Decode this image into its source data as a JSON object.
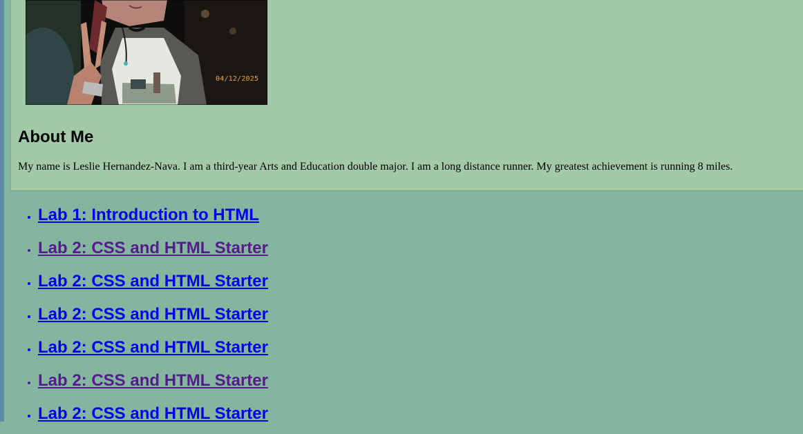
{
  "photo": {
    "date_stamp": "04/12/2025"
  },
  "about": {
    "heading": "About Me",
    "text": "My name is Leslie Hernandez-Nava. I am a third-year Arts and Education double major. I am a long distance runner. My greatest achievement is running 8 miles."
  },
  "labs": [
    {
      "label": "Lab 1: Introduction to HTML",
      "visited": false
    },
    {
      "label": "Lab 2: CSS and HTML Starter",
      "visited": true
    },
    {
      "label": "Lab 2: CSS and HTML Starter",
      "visited": false
    },
    {
      "label": "Lab 2: CSS and HTML Starter",
      "visited": false
    },
    {
      "label": "Lab 2: CSS and HTML Starter",
      "visited": false
    },
    {
      "label": "Lab 2: CSS and HTML Starter",
      "visited": true
    },
    {
      "label": "Lab 2: CSS and HTML Starter",
      "visited": false
    }
  ],
  "colors": {
    "page_background": "#84b59e",
    "about_background": "#a3caa8",
    "link_unvisited": "#0000ee",
    "link_visited": "#551a8b"
  }
}
